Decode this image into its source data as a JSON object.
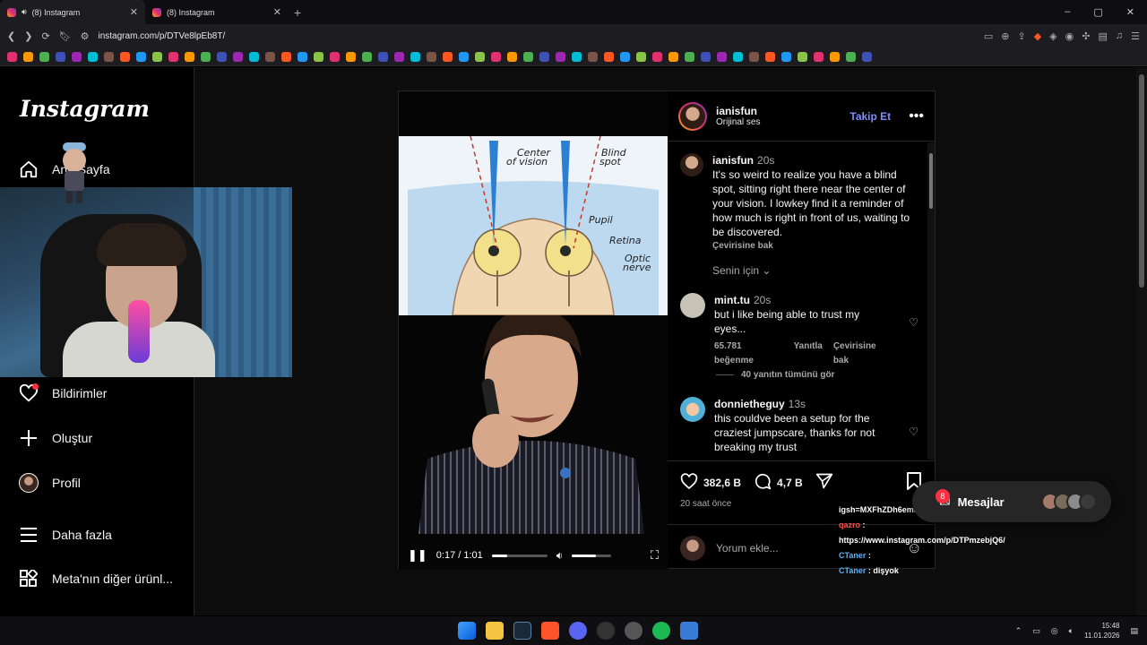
{
  "browser": {
    "tabs": [
      {
        "title": "(8) Instagram",
        "active": true
      },
      {
        "title": "(8) Instagram",
        "active": false
      }
    ],
    "url": "instagram.com/p/DTVe8lpEb8T/",
    "new_tab": "+",
    "window_controls": [
      "–",
      "▢",
      "✕"
    ]
  },
  "sidebar": {
    "logo": "Instagram",
    "items": [
      {
        "label": "Ana Sayfa",
        "icon": "home-icon"
      },
      {
        "label": "Bildirimler",
        "icon": "heart-icon"
      },
      {
        "label": "Oluştur",
        "icon": "plus-icon"
      },
      {
        "label": "Profil",
        "icon": "avatar"
      },
      {
        "label": "Daha fazla",
        "icon": "menu-icon"
      },
      {
        "label": "Meta'nın diğer ürünl...",
        "icon": "apps-icon"
      }
    ],
    "home_visible_fragment": "A",
    "home_visible_tail": "ayfa"
  },
  "video": {
    "diagram_labels": {
      "center": "Center",
      "of_vision": "of vision",
      "blind": "Blind",
      "spot": "spot",
      "pupil": "Pupil",
      "retina": "Retina",
      "optic": "Optic",
      "nerve": "nerve"
    },
    "time": "0:17 / 1:01",
    "progress_fraction": 0.28,
    "volume_fraction": 0.6
  },
  "post": {
    "author": "ianisfun",
    "audio": "Orijinal ses",
    "follow_label": "Takip Et",
    "more": "•••",
    "caption": {
      "user": "ianisfun",
      "time": "20s",
      "text": "It's so weird to realize you have a blind spot, sitting right there near the center of your vision. I lowkey find it a reminder of how much is right in front of us, waiting to be discovered.",
      "translate": "Çevirisine bak"
    },
    "filter_label": "Senin için",
    "comments": [
      {
        "user": "mint.tu",
        "time": "20s",
        "text": "but i like being able to trust my eyes...",
        "likes": "65.781 beğenme",
        "reply": "Yanıtla",
        "translate": "Çevirisine bak",
        "view_replies": "40 yanıtın tümünü gör"
      },
      {
        "user": "donnietheguy",
        "time": "13s",
        "text": "this couldve been a setup for the craziest jumpscare, thanks for not breaking my trust"
      }
    ],
    "likes": "382,6 B",
    "comment_count": "4,7 B",
    "posted_ago": "20 saat önce",
    "add_comment_placeholder": "Yorum ekle..."
  },
  "messages": {
    "label": "Mesajlar",
    "badge": "8"
  },
  "chat_overlay": [
    {
      "user": "",
      "text": "igsh=MXFhZDh6eml0cDByaA=="
    },
    {
      "user": "qazro",
      "text": ": https://www.instagram.com/p/DTPmzebjQ6/"
    },
    {
      "user": "CTaner",
      "text": ":"
    },
    {
      "user": "CTaner",
      "text": ": dişyok"
    },
    {
      "user": "CTaner",
      "text": ":"
    }
  ],
  "taskbar": {
    "time": "15:48",
    "date": "11.01.2026"
  },
  "colors": {
    "accent_follow": "#7f8cff",
    "notification": "#ff3040",
    "background": "#000000"
  }
}
